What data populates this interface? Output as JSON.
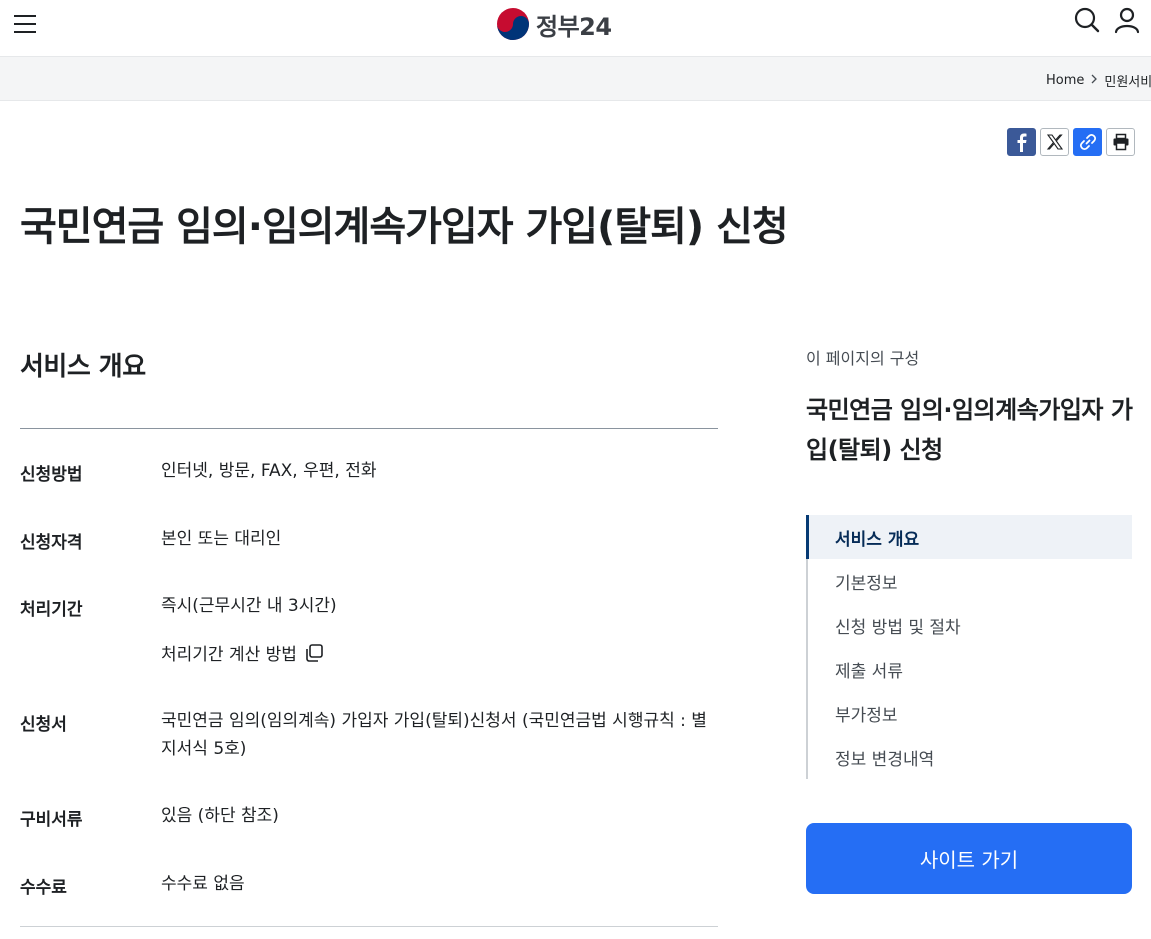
{
  "header": {
    "logo_text": "정부24",
    "menu_icon": "menu-icon",
    "search_icon": "search-icon",
    "user_icon": "user-icon"
  },
  "breadcrumb": {
    "home": "Home",
    "current": "민원서비스"
  },
  "share": {
    "items": [
      "facebook-icon",
      "x-icon",
      "link-icon",
      "print-icon"
    ]
  },
  "page": {
    "title": "국민연금 임의·임의계속가입자 가입(탈퇴) 신청"
  },
  "overview": {
    "section_title": "서비스 개요",
    "rows": [
      {
        "label": "신청방법",
        "value": "인터넷, 방문, FAX, 우편, 전화"
      },
      {
        "label": "신청자격",
        "value": "본인 또는 대리인"
      },
      {
        "label": "처리기간",
        "value": "즉시(근무시간 내 3시간)"
      },
      {
        "label": "신청서",
        "value": "국민연금 임의(임의계속) 가입자 가입(탈퇴)신청서 (국민연금법 시행규칙 : 별지서식 5호)"
      },
      {
        "label": "구비서류",
        "value": "있음 (하단 참조)"
      },
      {
        "label": "수수료",
        "value": "수수료 없음"
      }
    ],
    "calc_link": "처리기간 계산 방법"
  },
  "sidebar": {
    "caption": "이 페이지의 구성",
    "title": "국민연금 임의·임의계속가입자 가입(탈퇴) 신청",
    "items": [
      {
        "label": "서비스 개요",
        "active": true
      },
      {
        "label": "기본정보"
      },
      {
        "label": "신청 방법 및 절차"
      },
      {
        "label": "제출 서류"
      },
      {
        "label": "부가정보"
      },
      {
        "label": "정보 변경내역"
      }
    ],
    "site_button": "사이트 가기"
  },
  "colors": {
    "primary": "#256ef4",
    "active_nav": "#063a74",
    "text": "#1e2124"
  }
}
